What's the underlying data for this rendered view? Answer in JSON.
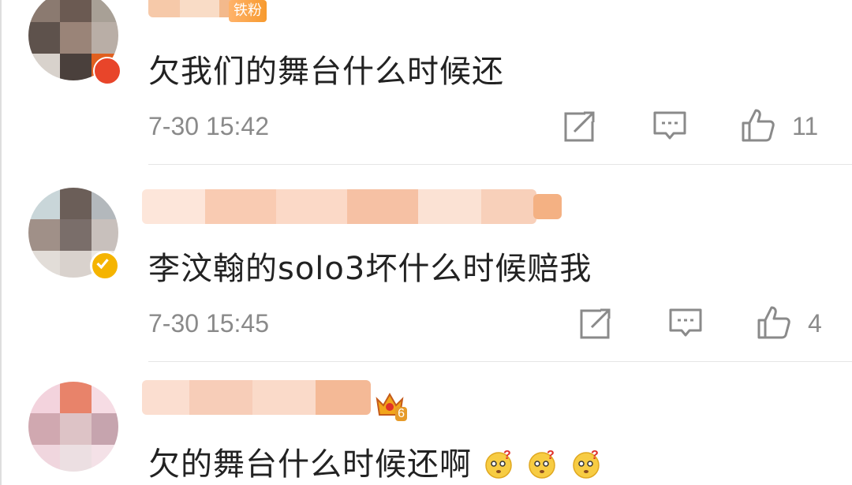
{
  "comments": [
    {
      "badge": "铁粉",
      "text": "欠我们的舞台什么时候还",
      "time": "7-30 15:42",
      "likes": "11"
    },
    {
      "text": "李汶翰的solo3坏什么时候赔我",
      "time": "7-30 15:45",
      "likes": "4"
    },
    {
      "crown_level": "6",
      "text": "欠的舞台什么时候还啊",
      "emojis": [
        "confused-face-icon",
        "confused-face-icon",
        "confused-face-icon"
      ]
    }
  ],
  "colors": {
    "accent": "#f79a2e",
    "verified": "#f5b400",
    "text": "#222222",
    "meta": "#8a8a8a"
  }
}
